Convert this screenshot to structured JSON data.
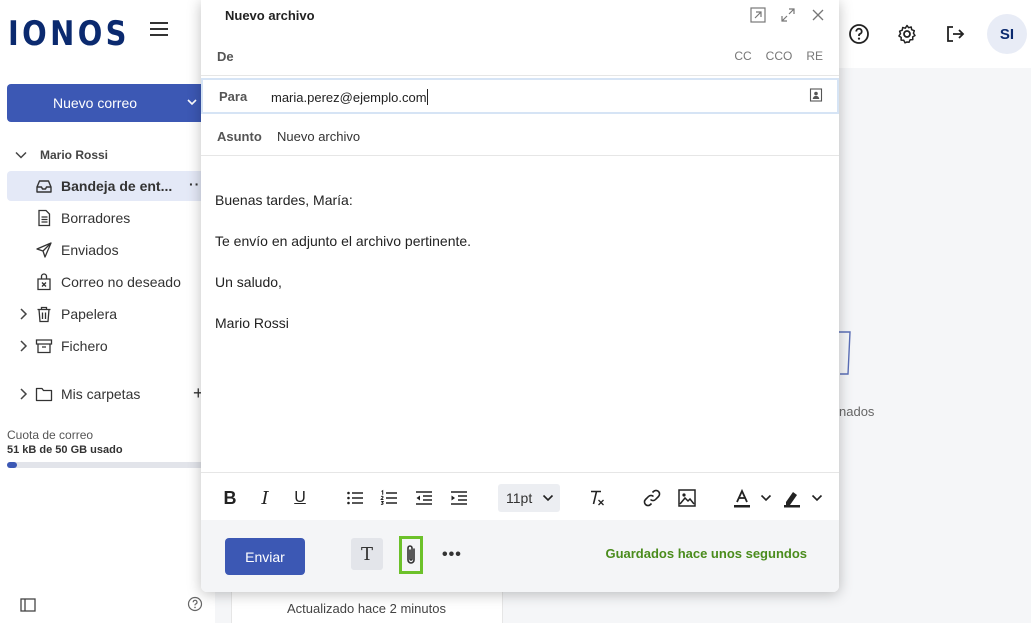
{
  "header": {
    "logo": "IONOS",
    "avatar": "SI",
    "icons": [
      "help-icon",
      "settings-icon",
      "logout-icon"
    ]
  },
  "sidebar": {
    "new_mail_label": "Nuevo correo",
    "account_name": "Mario Rossi",
    "folders": [
      {
        "label": "Bandeja de entrada",
        "icon": "inbox-icon"
      },
      {
        "label": "Borradores",
        "icon": "drafts-icon"
      },
      {
        "label": "Enviados",
        "icon": "send-icon"
      },
      {
        "label": "Correo no deseado",
        "icon": "spam-icon"
      },
      {
        "label": "Papelera",
        "icon": "trash-icon"
      },
      {
        "label": "Fichero",
        "icon": "archive-icon"
      },
      {
        "label": "Mis carpetas",
        "icon": "folder-icon"
      }
    ],
    "active_folder_display": "Bandeja de ent...",
    "quota_label": "Cuota de correo",
    "quota_value": "51 kB de 50 GB usado",
    "quota_fraction": 0.001
  },
  "background": {
    "updated_text": "Actualizado hace 2 minutos",
    "right_partial_text": "nados"
  },
  "compose": {
    "title": "Nuevo archivo",
    "from_label": "De",
    "cc_label": "CC",
    "bcc_label": "CCO",
    "reply_label": "RE",
    "to_label": "Para",
    "to_value": "maria.perez@ejemplo.com",
    "subject_label": "Asunto",
    "subject_value": "Nuevo archivo",
    "body_lines": [
      "Buenas tardes, María:",
      "Te envío en adjunto el archivo pertinente.",
      "Un saludo,",
      "Mario Rossi"
    ],
    "font_size": "11pt",
    "send_label": "Enviar",
    "format_glyph": "T",
    "more_glyph": "•••",
    "saved_status": "Guardados hace unos segundos"
  },
  "colors": {
    "brand": "#0b2a6f",
    "primary_button": "#3c58b4",
    "saved_green": "#4a8c1c",
    "attach_highlight": "#6cc12a"
  }
}
